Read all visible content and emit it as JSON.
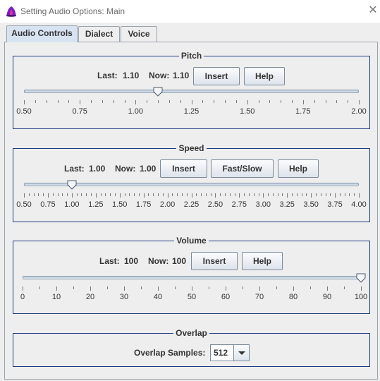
{
  "window": {
    "title": "Setting Audio Options: Main",
    "close_symbol": "✕"
  },
  "tabs": [
    {
      "label": "Audio Controls",
      "active": true
    },
    {
      "label": "Dialect",
      "active": false
    },
    {
      "label": "Voice",
      "active": false
    }
  ],
  "pitch": {
    "title": "Pitch",
    "last_label": "Last:",
    "last_value": "1.10",
    "now_label": "Now:",
    "now_value": "1.10",
    "buttons": {
      "insert": "Insert",
      "help": "Help"
    },
    "slider": {
      "min": 0.5,
      "max": 2.0,
      "value": 1.1,
      "minor_step": 0.05,
      "labels": [
        "0.50",
        "0.75",
        "1.00",
        "1.25",
        "1.50",
        "1.75",
        "2.00"
      ]
    }
  },
  "speed": {
    "title": "Speed",
    "last_label": "Last:",
    "last_value": "1.00",
    "now_label": "Now:",
    "now_value": "1.00",
    "buttons": {
      "insert": "Insert",
      "fast_slow": "Fast/Slow",
      "help": "Help"
    },
    "slider": {
      "min": 0.5,
      "max": 4.0,
      "value": 1.0,
      "minor_step": 0.05,
      "labels": [
        "0.50",
        "0.75",
        "1.00",
        "1.25",
        "1.50",
        "1.75",
        "2.00",
        "2.25",
        "2.50",
        "2.75",
        "3.00",
        "3.25",
        "3.50",
        "3.75",
        "4.00"
      ]
    }
  },
  "volume": {
    "title": "Volume",
    "last_label": "Last:",
    "last_value": "100",
    "now_label": "Now:",
    "now_value": "100",
    "buttons": {
      "insert": "Insert",
      "help": "Help"
    },
    "slider": {
      "min": 0,
      "max": 100,
      "value": 100,
      "minor_step": 5,
      "labels": [
        "0",
        "10",
        "20",
        "30",
        "40",
        "50",
        "60",
        "70",
        "80",
        "90",
        "100"
      ]
    }
  },
  "overlap": {
    "title": "Overlap",
    "samples_label": "Overlap Samples:",
    "samples_value": "512"
  },
  "colors": {
    "group_border": "#1e3a80",
    "tab_active": "#d7e3f1",
    "background": "#eeeeee"
  }
}
